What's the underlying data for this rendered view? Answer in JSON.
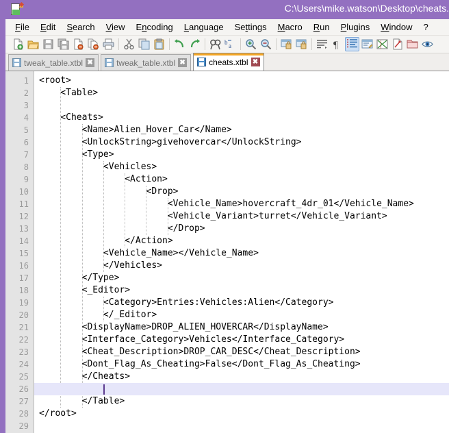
{
  "window": {
    "title": "C:\\Users\\mike.watson\\Desktop\\cheats.",
    "title_color": "#9370c0",
    "app_icon": "notepad-plus-plus-icon"
  },
  "menubar": {
    "items": [
      {
        "label": "File",
        "accel": "F"
      },
      {
        "label": "Edit",
        "accel": "E"
      },
      {
        "label": "Search",
        "accel": "S"
      },
      {
        "label": "View",
        "accel": "V"
      },
      {
        "label": "Encoding",
        "accel": "n"
      },
      {
        "label": "Language",
        "accel": "L"
      },
      {
        "label": "Settings",
        "accel": "t"
      },
      {
        "label": "Macro",
        "accel": "M"
      },
      {
        "label": "Run",
        "accel": "R"
      },
      {
        "label": "Plugins",
        "accel": "P"
      },
      {
        "label": "Window",
        "accel": "W"
      },
      {
        "label": "?",
        "accel": ""
      }
    ]
  },
  "toolbar": {
    "buttons": [
      {
        "name": "new-file-icon",
        "active": false
      },
      {
        "name": "open-file-icon",
        "active": false
      },
      {
        "name": "save-icon",
        "active": false
      },
      {
        "name": "save-all-icon",
        "active": false
      },
      {
        "name": "close-file-icon",
        "active": false
      },
      {
        "name": "close-all-files-icon",
        "active": false
      },
      {
        "name": "print-icon",
        "active": false
      },
      {
        "name": "separator",
        "active": false
      },
      {
        "name": "cut-icon",
        "active": false
      },
      {
        "name": "copy-icon",
        "active": false
      },
      {
        "name": "paste-icon",
        "active": false
      },
      {
        "name": "separator",
        "active": false
      },
      {
        "name": "undo-icon",
        "active": false
      },
      {
        "name": "redo-icon",
        "active": false
      },
      {
        "name": "separator",
        "active": false
      },
      {
        "name": "find-icon",
        "active": false
      },
      {
        "name": "replace-icon",
        "active": false
      },
      {
        "name": "separator",
        "active": false
      },
      {
        "name": "zoom-in-icon",
        "active": false
      },
      {
        "name": "zoom-out-icon",
        "active": false
      },
      {
        "name": "separator",
        "active": false
      },
      {
        "name": "sync-vertical-scroll-icon",
        "active": false
      },
      {
        "name": "sync-horizontal-scroll-icon",
        "active": false
      },
      {
        "name": "separator",
        "active": false
      },
      {
        "name": "word-wrap-icon",
        "active": false
      },
      {
        "name": "show-all-characters-icon",
        "active": false
      },
      {
        "name": "indent-guide-icon",
        "active": true
      },
      {
        "name": "user-defined-dialog-icon",
        "active": false
      },
      {
        "name": "document-map-icon",
        "active": false
      },
      {
        "name": "function-list-icon",
        "active": false
      },
      {
        "name": "folder-as-workspace-icon",
        "active": false
      },
      {
        "name": "monitor-file-icon",
        "active": false
      }
    ]
  },
  "tabs": [
    {
      "label": "tweak_table.xtbl",
      "active": false,
      "icon": "saved-file-icon",
      "close": "✖"
    },
    {
      "label": "tweak_table.xtbl",
      "active": false,
      "icon": "saved-file-icon",
      "close": "✖"
    },
    {
      "label": "cheats.xtbl",
      "active": true,
      "icon": "saved-file-icon",
      "close": "✖"
    }
  ],
  "editor": {
    "current_line": 26,
    "caret_indent": 12,
    "total_lines": 29,
    "lines": [
      {
        "n": 1,
        "text": "<root>"
      },
      {
        "n": 2,
        "text": "    <Table>"
      },
      {
        "n": 3,
        "text": ""
      },
      {
        "n": 4,
        "text": "    <Cheats>"
      },
      {
        "n": 5,
        "text": "        <Name>Alien_Hover_Car</Name>"
      },
      {
        "n": 6,
        "text": "        <UnlockString>givehovercar</UnlockString>"
      },
      {
        "n": 7,
        "text": "        <Type>"
      },
      {
        "n": 8,
        "text": "            <Vehicles>"
      },
      {
        "n": 9,
        "text": "                <Action>"
      },
      {
        "n": 10,
        "text": "                    <Drop>"
      },
      {
        "n": 11,
        "text": "                        <Vehicle_Name>hovercraft_4dr_01</Vehicle_Name>"
      },
      {
        "n": 12,
        "text": "                        <Vehicle_Variant>turret</Vehicle_Variant>"
      },
      {
        "n": 13,
        "text": "                        </Drop>"
      },
      {
        "n": 14,
        "text": "                </Action>"
      },
      {
        "n": 15,
        "text": "            <Vehicle_Name></Vehicle_Name>"
      },
      {
        "n": 16,
        "text": "            </Vehicles>"
      },
      {
        "n": 17,
        "text": "        </Type>"
      },
      {
        "n": 18,
        "text": "        <_Editor>"
      },
      {
        "n": 19,
        "text": "            <Category>Entries:Vehicles:Alien</Category>"
      },
      {
        "n": 20,
        "text": "            </_Editor>"
      },
      {
        "n": 21,
        "text": "        <DisplayName>DROP_ALIEN_HOVERCAR</DisplayName>"
      },
      {
        "n": 22,
        "text": "        <Interface_Category>Vehicles</Interface_Category>"
      },
      {
        "n": 23,
        "text": "        <Cheat_Description>DROP_CAR_DESC</Cheat_Description>"
      },
      {
        "n": 24,
        "text": "        <Dont_Flag_As_Cheating>False</Dont_Flag_As_Cheating>"
      },
      {
        "n": 25,
        "text": "        </Cheats>"
      },
      {
        "n": 26,
        "text": ""
      },
      {
        "n": 27,
        "text": "        </Table>"
      },
      {
        "n": 28,
        "text": "</root>"
      },
      {
        "n": 29,
        "text": ""
      }
    ]
  },
  "colors": {
    "title_bar": "#9370c0",
    "active_tab_accent": "#f5a623",
    "current_line_highlight": "#e6e6fa",
    "gutter_bg": "#e4e4e4",
    "line_number": "#9b9b9b",
    "code_text": "#000000",
    "caret": "#5b3a8e"
  }
}
